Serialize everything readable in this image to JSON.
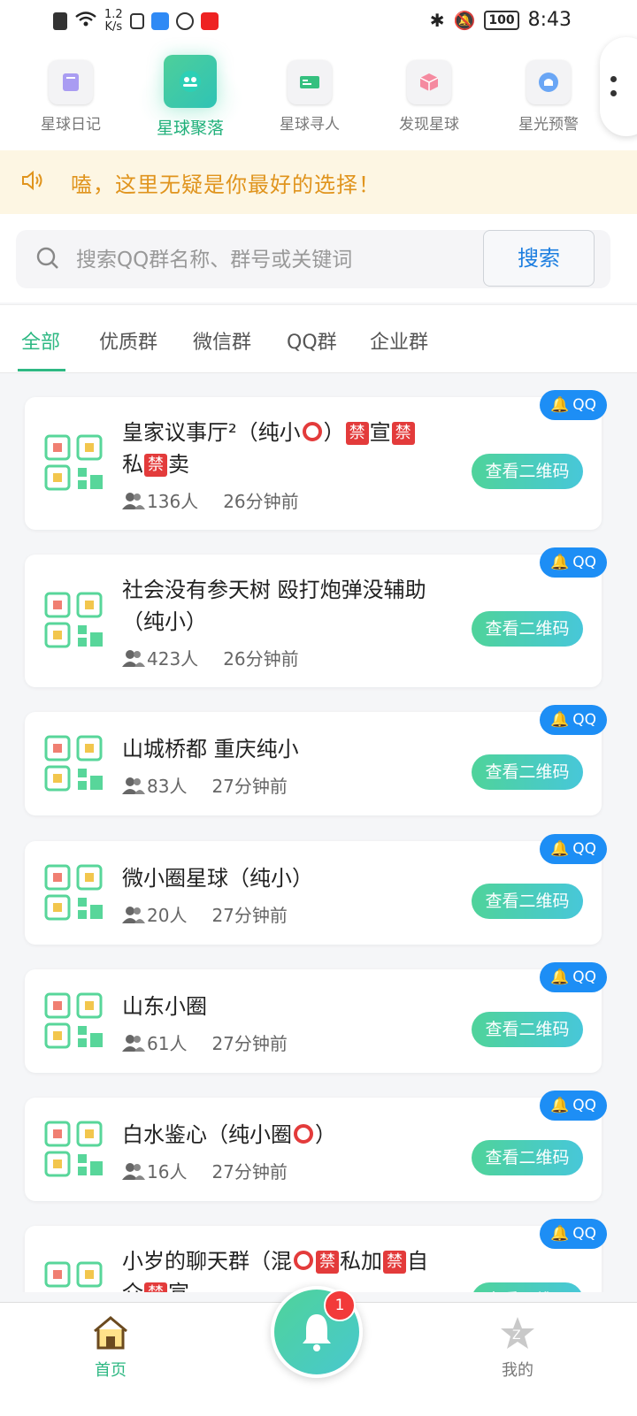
{
  "status_bar": {
    "speed": "1.2\nK/s",
    "battery": "100",
    "time": "8:43"
  },
  "top_nav": [
    {
      "label": "星球日记",
      "active": false
    },
    {
      "label": "星球聚落",
      "active": true
    },
    {
      "label": "星球寻人",
      "active": false
    },
    {
      "label": "发现星球",
      "active": false
    },
    {
      "label": "星光预警",
      "active": false
    }
  ],
  "notice": {
    "text": "嗑，这里无疑是你最好的选择！"
  },
  "search": {
    "placeholder": "搜索QQ群名称、群号或关键词",
    "button_label": "搜索"
  },
  "tabs": [
    {
      "label": "全部",
      "active": true
    },
    {
      "label": "优质群",
      "active": false
    },
    {
      "label": "微信群",
      "active": false
    },
    {
      "label": "QQ群",
      "active": false
    },
    {
      "label": "企业群",
      "active": false
    }
  ],
  "groups": [
    {
      "title": "皇家议事厅²（纯小⭕）🈲宣🈲私🈲卖",
      "members": "136人",
      "time": "26分钟前",
      "badge": "QQ",
      "button": "查看二维码"
    },
    {
      "title": "社会没有参天树 殴打炮弹没辅助（纯小）",
      "members": "423人",
      "time": "26分钟前",
      "badge": "QQ",
      "button": "查看二维码"
    },
    {
      "title": "山城桥都 重庆纯小",
      "members": "83人",
      "time": "27分钟前",
      "badge": "QQ",
      "button": "查看二维码"
    },
    {
      "title": "微小圈星球（纯小）",
      "members": "20人",
      "time": "27分钟前",
      "badge": "QQ",
      "button": "查看二维码"
    },
    {
      "title": "山东小圈",
      "members": "61人",
      "time": "27分钟前",
      "badge": "QQ",
      "button": "查看二维码"
    },
    {
      "title": "白水鉴心（纯小圈⭕）",
      "members": "16人",
      "time": "27分钟前",
      "badge": "QQ",
      "button": "查看二维码"
    },
    {
      "title": "小岁的聊天群（混⭕🈲私加🈲自介🈲宣",
      "members": "",
      "time": "",
      "badge": "QQ",
      "button": "查看二维码"
    }
  ],
  "bottom_nav": {
    "home_label": "首页",
    "mine_label": "我的",
    "notification_count": "1"
  }
}
